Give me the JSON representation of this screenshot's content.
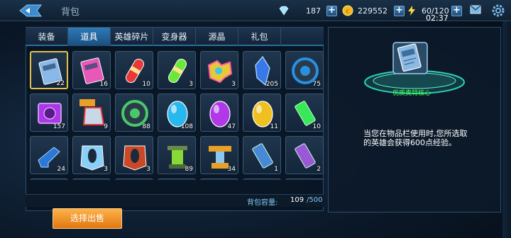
{
  "header": {
    "title": "背包",
    "diamonds": "187",
    "gold": "229552",
    "energy": "60/120",
    "time": "02:37"
  },
  "tabs": [
    {
      "label": "装备",
      "active": false
    },
    {
      "label": "道具",
      "active": true
    },
    {
      "label": "英雄碎片",
      "active": false
    },
    {
      "label": "变身器",
      "active": false
    },
    {
      "label": "源晶",
      "active": false
    },
    {
      "label": "礼包",
      "active": false
    }
  ],
  "inventory": [
    {
      "icon": "card-icon",
      "count": "22",
      "color": "#8ab8e8",
      "selected": true
    },
    {
      "icon": "pink-card-icon",
      "count": "16",
      "color": "#e858b8"
    },
    {
      "icon": "red-capsule-icon",
      "count": "10",
      "color": "#e83838"
    },
    {
      "icon": "green-capsule-icon",
      "count": "3",
      "color": "#6ae838"
    },
    {
      "icon": "rainbow-puzzle-icon",
      "count": "3",
      "color": "#e8c838"
    },
    {
      "icon": "blue-crystal-icon",
      "count": "205",
      "color": "#3878e8"
    },
    {
      "icon": "blue-orb-icon",
      "count": "75",
      "color": "#2890e0"
    },
    {
      "icon": "purple-scroll-icon",
      "count": "157",
      "color": "#a838e8"
    },
    {
      "icon": "ultra-badge-icon",
      "count": "9",
      "color": "#e83838"
    },
    {
      "icon": "green-ring-icon",
      "count": "88",
      "color": "#48c868"
    },
    {
      "icon": "blue-gem-icon",
      "count": "108",
      "color": "#28b8f0"
    },
    {
      "icon": "purple-gem-icon",
      "count": "47",
      "color": "#b038e8"
    },
    {
      "icon": "yellow-gem-icon",
      "count": "11",
      "color": "#f0c020"
    },
    {
      "icon": "green-bar-icon",
      "count": "10",
      "color": "#38e858"
    },
    {
      "icon": "blue-whistle-icon",
      "count": "24",
      "color": "#2a78d8"
    },
    {
      "icon": "ice-armor-icon",
      "count": "3",
      "color": "#88d0f8"
    },
    {
      "icon": "red-armor-icon",
      "count": "3",
      "color": "#c84828"
    },
    {
      "icon": "green-device-icon",
      "count": "89",
      "color": "#88d838"
    },
    {
      "icon": "gold-tower-icon",
      "count": "34",
      "color": "#e8a028"
    },
    {
      "icon": "blue-barrel-icon",
      "count": "1",
      "color": "#4888d8"
    },
    {
      "icon": "purple-barrel-icon",
      "count": "2",
      "color": "#9858d8"
    }
  ],
  "capacity": {
    "label": "背包容量:",
    "count": "109",
    "max": "/500"
  },
  "sell_button": "选择出售",
  "detail": {
    "name": "优质奥特核心",
    "description": "当您在物品栏使用时,您所选取的英雄会获得600点经验。"
  }
}
